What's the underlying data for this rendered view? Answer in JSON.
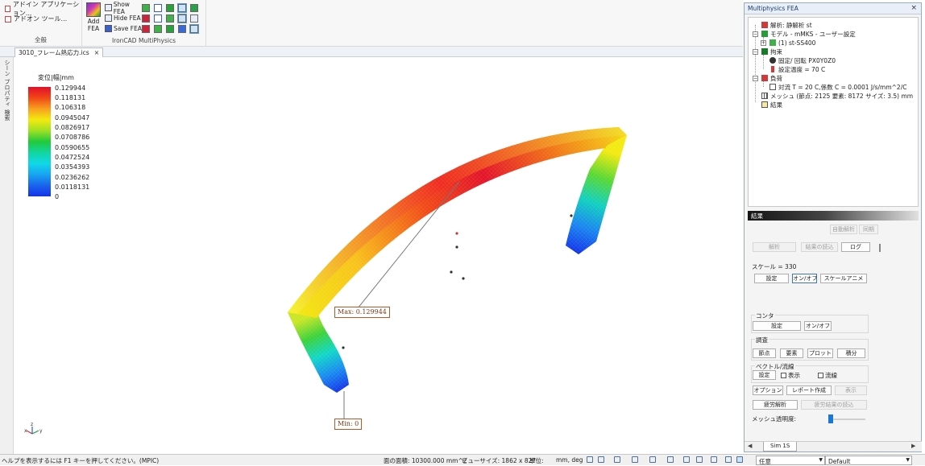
{
  "ribbon": {
    "addin_items": [
      "アドイン アプリケーション...",
      "アドオン ツール..."
    ],
    "group_general": "全般",
    "add_fea_label": "Add",
    "add_fea_label2": "FEA",
    "show_fea": "Show FEA",
    "hide_fea": "Hide FEA",
    "save_fea": "Save FEA",
    "group_ironcad": "IronCAD MultiPhysics"
  },
  "document": {
    "tab_title": "3010_フレーム熱応力.ics",
    "side_tabs": [
      "シーン",
      "プロパティ",
      "検索"
    ]
  },
  "legend": {
    "title": "変位|幅|mm",
    "ticks": [
      "0.129944",
      "0.118131",
      "0.106318",
      "0.0945047",
      "0.0826917",
      "0.0708786",
      "0.0590655",
      "0.0472524",
      "0.0354393",
      "0.0236262",
      "0.0118131",
      "0"
    ]
  },
  "callouts": {
    "max": "Max: 0.129944",
    "min": "Min: 0"
  },
  "triad": {
    "x": "x",
    "y": "y",
    "z": "z"
  },
  "panel": {
    "title": "Multiphysics FEA",
    "tree": {
      "analysis": "解析: 静解析 st",
      "model": "モデル - mMKS - ユーザー設定",
      "part": "(1)  st-SS400",
      "constraint": "拘束",
      "fixed": "固定/ 回転 PX0Y0Z0",
      "temp": "設定温度 = 70 C",
      "load": "負荷",
      "convection": "対流 T = 20 C,係数 C = 0.0001 J/s/mm^2/C",
      "mesh": "メッシュ (節点: 2125   要素: 8172  サイズ: 3.5) mm",
      "result": "結果"
    },
    "results_header": "結果",
    "auto_analysis": "自動解析",
    "sync": "同期",
    "analyze": "解析",
    "read_results": "結果の読込",
    "log": "ログ",
    "scale_text": "スケール = 330",
    "scale_settings": "設定",
    "scale_onoff": "オン/オフ",
    "scale_anim": "スケールアニメ",
    "contour_label": "コンタ",
    "contour_settings": "設定",
    "contour_onoff": "オン/オフ",
    "probe_label": "調査",
    "node": "節点",
    "element": "要素",
    "plot": "プロット",
    "integral": "積分",
    "vector_label": "ベクトル/流線",
    "vector_settings": "設定",
    "display_cb": "表示",
    "streamline_cb": "流線",
    "options": "オプション",
    "report": "レポート作成",
    "show": "表示",
    "fatigue": "疲労解析",
    "fatigue_read": "疲労結果の読込",
    "mesh_transparency": "メッシュ透明度:",
    "sim_tab": "Sim 1S"
  },
  "status": {
    "help": "ヘルプを表示するには F1 キーを押してください。(MPIC)",
    "area": "面の面積: 10300.000 mm^2",
    "viewsize": "ビューサイズ: 1862 x  827",
    "units_label": "単位:",
    "units": "mm, deg",
    "mode": "任意",
    "style": "Default"
  },
  "colors": {
    "max_red": "#e0102a",
    "min_blue": "#1433e8",
    "accent": "#1a77d6"
  }
}
